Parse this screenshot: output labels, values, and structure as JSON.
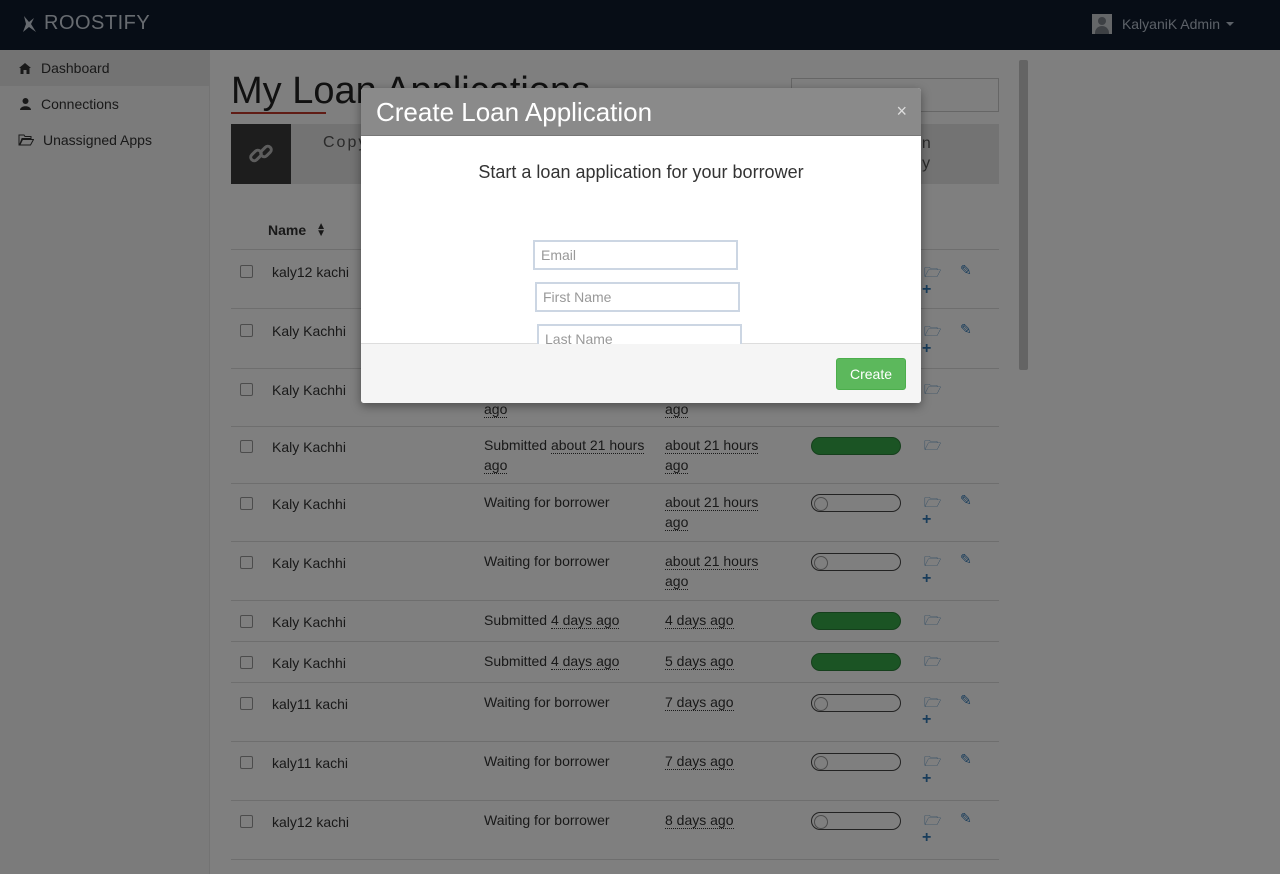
{
  "app": {
    "brand": "ROOSTIFY",
    "user": "KalyaniK Admin"
  },
  "sidebar": {
    "items": [
      {
        "label": "Dashboard",
        "icon": "home-icon"
      },
      {
        "label": "Connections",
        "icon": "user-icon"
      },
      {
        "label": "Unassigned Apps",
        "icon": "folder-open-icon"
      }
    ]
  },
  "main": {
    "title": "My Loan Applications",
    "banner": {
      "left_text": "Copy",
      "right_line1": "an",
      "right_line2": "lly"
    },
    "table_headers": {
      "name": "Name"
    },
    "rows": [
      {
        "name": "kaly12 kachi",
        "status": "",
        "updated": "",
        "toggle": "off",
        "add": true,
        "edit": true
      },
      {
        "name": "Kaly Kachhi",
        "status": "",
        "updated": "",
        "toggle": "off",
        "add": true,
        "edit": true
      },
      {
        "name": "Kaly Kachhi",
        "status": "ago",
        "updated": "ago",
        "toggle": "on",
        "add": false,
        "edit": false
      },
      {
        "name": "Kaly Kachhi",
        "status_prefix": "Submitted",
        "status": "about 21 hours ago",
        "updated": "about 21 hours ago",
        "toggle": "on",
        "add": false,
        "edit": false
      },
      {
        "name": "Kaly Kachhi",
        "status_prefix": "Waiting for borrower",
        "status": "",
        "updated": "about 21 hours ago",
        "toggle": "off",
        "add": true,
        "edit": true
      },
      {
        "name": "Kaly Kachhi",
        "status_prefix": "Waiting for borrower",
        "status": "",
        "updated": "about 21 hours ago",
        "toggle": "off",
        "add": true,
        "edit": true
      },
      {
        "name": "Kaly Kachhi",
        "status_prefix": "Submitted",
        "status": "4 days ago",
        "updated": "4 days ago",
        "toggle": "on",
        "add": false,
        "edit": false
      },
      {
        "name": "Kaly Kachhi",
        "status_prefix": "Submitted",
        "status": "4 days ago",
        "updated": "5 days ago",
        "toggle": "on",
        "add": false,
        "edit": false
      },
      {
        "name": "kaly11 kachi",
        "status_prefix": "Waiting for borrower",
        "status": "",
        "updated": "7 days ago",
        "toggle": "off",
        "add": true,
        "edit": true
      },
      {
        "name": "kaly11 kachi",
        "status_prefix": "Waiting for borrower",
        "status": "",
        "updated": "7 days ago",
        "toggle": "off",
        "add": true,
        "edit": true
      },
      {
        "name": "kaly12 kachi",
        "status_prefix": "Waiting for borrower",
        "status": "",
        "updated": "8 days ago",
        "toggle": "off",
        "add": true,
        "edit": true
      }
    ]
  },
  "modal": {
    "title": "Create Loan Application",
    "close_label": "×",
    "subtitle": "Start a loan application for your borrower",
    "email_placeholder": "Email",
    "first_name_placeholder": "First Name",
    "last_name_placeholder": "Last Name",
    "create_label": "Create"
  },
  "colors": {
    "topbar": "#0f1b2d",
    "accent": "#5cb85c",
    "link": "#337ab7"
  }
}
